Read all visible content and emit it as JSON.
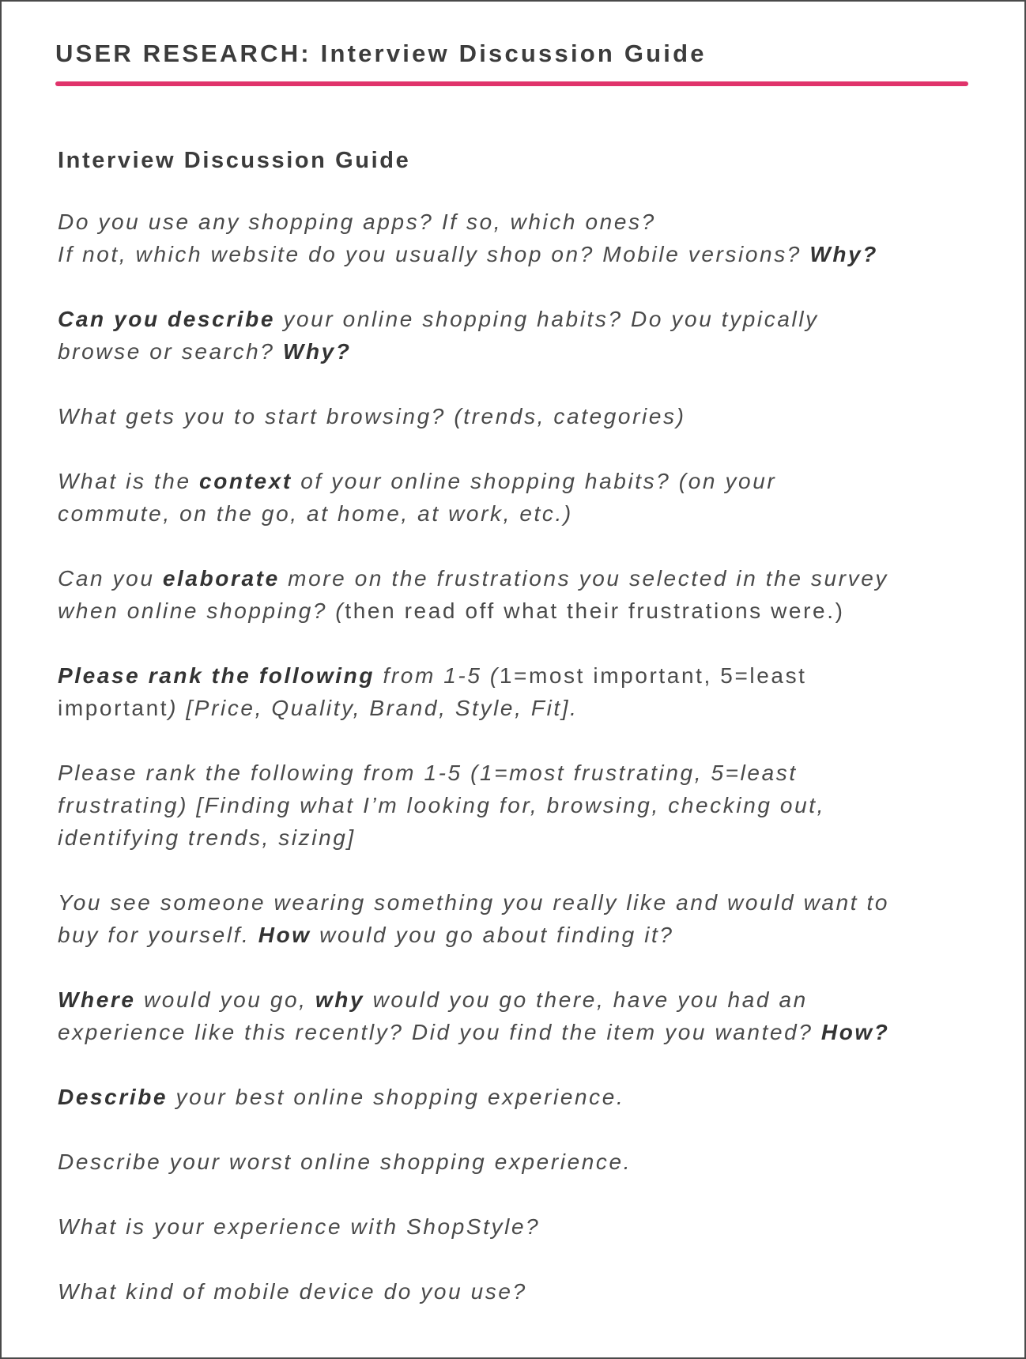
{
  "header": {
    "title": "USER RESEARCH: Interview Discussion Guide",
    "accent_color": "#e0336b"
  },
  "guide": {
    "title": "Interview Discussion Guide",
    "questions": [
      {
        "line1": {
          "part1": "Do you use any shopping apps? If so, which ones?"
        },
        "line2": {
          "part1": "If not, which website do you usually shop on? Mobile versions? ",
          "bold1": "Why?"
        }
      },
      {
        "line1": {
          "bold1": "Can you describe",
          "part1": " your online shopping habits? Do you typically"
        },
        "line2": {
          "part1": "browse or search? ",
          "bold1": "Why?"
        }
      },
      {
        "line1": {
          "part1": "What gets you to start browsing? (trends, categories)"
        }
      },
      {
        "line1": {
          "part1": "What is the ",
          "bold1": "context",
          "part2": " of your online shopping habits? (on your"
        },
        "line2": {
          "part1": "commute, on the go, at home, at work, etc.)"
        }
      },
      {
        "line1": {
          "part1": "Can you ",
          "bold1": "elaborate",
          "part2": " more on the frustrations you selected in the survey"
        },
        "line2": {
          "part1": "when online shopping? (",
          "upright1": "then read off what their frustrations were.)"
        }
      },
      {
        "line1": {
          "bold1": "Please rank the following",
          "part1": " from 1-5 (",
          "upright1": "1=most important, 5=least"
        },
        "line2": {
          "upright1": "important",
          "part1": ") [Price, Quality, Brand, Style, Fit]."
        }
      },
      {
        "line1": {
          "part1": "Please rank the following from 1-5 (1=most frustrating, 5=least"
        },
        "line2": {
          "part1": "frustrating) [Finding what I’m looking for, browsing, checking out,"
        },
        "line3": {
          "part1": "identifying trends, sizing]"
        }
      },
      {
        "line1": {
          "part1": "You see someone wearing something you really like and would want to"
        },
        "line2": {
          "part1": "buy for yourself. ",
          "bold1": "How",
          "part2": " would you go about finding it?"
        }
      },
      {
        "line1": {
          "bold1": "Where",
          "part1": " would you go, ",
          "bold2": "why",
          "part2": " would you go there, have you had an"
        },
        "line2": {
          "part1": "experience like this recently? Did you find the item you wanted? ",
          "bold1": "How?"
        }
      },
      {
        "line1": {
          "bold1": "Describe",
          "part1": " your best online shopping experience."
        }
      },
      {
        "line1": {
          "part1": "Describe your worst online shopping experience."
        }
      },
      {
        "line1": {
          "part1": "What is your experience with ShopStyle?"
        }
      },
      {
        "line1": {
          "part1": "What kind of mobile device do you use?"
        }
      }
    ]
  }
}
